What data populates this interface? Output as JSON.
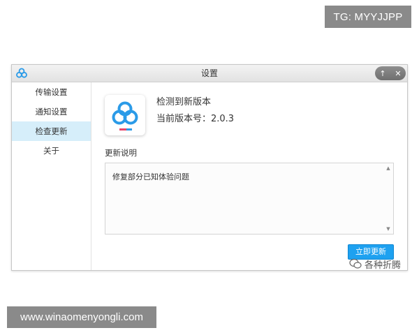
{
  "overlay": {
    "top_tag": "TG: MYYJJPP",
    "bottom_tag": "www.winaomenyongli.com",
    "watermark": "各种折腾"
  },
  "window": {
    "title": "设置",
    "controls": {
      "minimize": "↑",
      "close": "✕"
    }
  },
  "sidebar": {
    "items": [
      {
        "label": "传输设置",
        "active": false
      },
      {
        "label": "通知设置",
        "active": false
      },
      {
        "label": "检查更新",
        "active": true
      },
      {
        "label": "关于",
        "active": false
      }
    ]
  },
  "main": {
    "update_title": "检测到新版本",
    "current_version": "当前版本号：2.0.3",
    "notes_label": "更新说明",
    "notes_text": "修复部分已知体验问题",
    "update_button": "立即更新"
  },
  "colors": {
    "accent": "#1ea1f0",
    "sidebar_active": "#d6eefa",
    "logo_blue": "#2b9be8",
    "logo_pink": "#e8476b"
  },
  "icons": {
    "app": "baidu-netdisk-logo-icon",
    "minimize": "arrow-up-icon",
    "close": "close-icon",
    "scroll_up": "scroll-up-arrow-icon",
    "scroll_down": "scroll-down-arrow-icon",
    "watermark": "wechat-icon"
  }
}
